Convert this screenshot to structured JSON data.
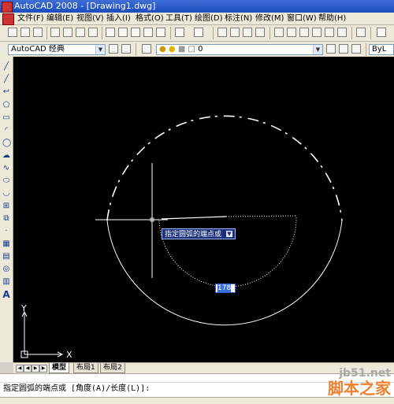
{
  "window": {
    "title": "AutoCAD 2008 - [Drawing1.dwg]"
  },
  "menu": {
    "items": [
      "文件(F)",
      "编辑(E)",
      "视图(V)",
      "插入(I)",
      "格式(O)",
      "工具(T)",
      "绘图(D)",
      "标注(N)",
      "修改(M)",
      "窗口(W)",
      "帮助(H)"
    ]
  },
  "toolbar2": {
    "workspace": "AutoCAD 经典",
    "layer": "0",
    "linetype": "ByL"
  },
  "tooltip": {
    "text": "指定圆弧的端点或"
  },
  "dynamic_input": {
    "value": "178"
  },
  "ucs": {
    "x_label": "X",
    "y_label": "Y"
  },
  "tabs": [
    "模型",
    "布局1",
    "布局2"
  ],
  "command": {
    "prompt": "指定圆弧的端点或 [角度(A)/长度(L)]:"
  },
  "watermark": {
    "url": "jb51.net",
    "name": "脚本之家"
  }
}
